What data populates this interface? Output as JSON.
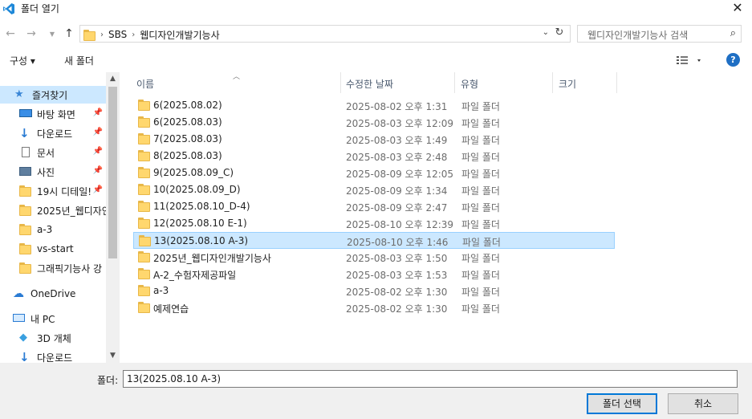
{
  "window": {
    "title": "폴더 열기",
    "close_icon": "close-icon"
  },
  "address": {
    "crumbs": [
      "SBS",
      "웹디자인개발기능사"
    ],
    "search_placeholder": "웹디자인개발기능사 검색"
  },
  "toolbar": {
    "organize_label": "구성 ▾",
    "new_folder_label": "새 폴더"
  },
  "nav": {
    "items": [
      {
        "label": "즐겨찾기",
        "icon": "star-icon",
        "pinned": false
      },
      {
        "label": "바탕 화면",
        "icon": "desktop-icon",
        "pinned": true
      },
      {
        "label": "다운로드",
        "icon": "download-icon",
        "pinned": true
      },
      {
        "label": "문서",
        "icon": "document-icon",
        "pinned": true
      },
      {
        "label": "사진",
        "icon": "picture-icon",
        "pinned": true
      },
      {
        "label": "19시 디테일!",
        "icon": "folder-icon",
        "pinned": true
      },
      {
        "label": "2025년_웹디자인",
        "icon": "folder-icon",
        "pinned": false
      },
      {
        "label": "a-3",
        "icon": "folder-icon",
        "pinned": false
      },
      {
        "label": "vs-start",
        "icon": "folder-icon",
        "pinned": false
      },
      {
        "label": "그래픽기능사 강",
        "icon": "folder-icon",
        "pinned": false
      },
      {
        "label": "OneDrive",
        "icon": "cloud-icon",
        "pinned": false
      },
      {
        "label": "내 PC",
        "icon": "pc-icon",
        "pinned": false
      },
      {
        "label": "3D 개체",
        "icon": "cube-icon",
        "pinned": false
      },
      {
        "label": "다운로드",
        "icon": "download-icon",
        "pinned": false
      }
    ]
  },
  "columns": {
    "name": "이름",
    "modified": "수정한 날짜",
    "type": "유형",
    "size": "크기"
  },
  "files": [
    {
      "name": "6(2025.08.02)",
      "modified": "2025-08-02 오후 1:31",
      "type": "파일 폴더",
      "selected": false
    },
    {
      "name": "6(2025.08.03)",
      "modified": "2025-08-03 오후 12:09",
      "type": "파일 폴더",
      "selected": false
    },
    {
      "name": "7(2025.08.03)",
      "modified": "2025-08-03 오후 1:49",
      "type": "파일 폴더",
      "selected": false
    },
    {
      "name": "8(2025.08.03)",
      "modified": "2025-08-03 오후 2:48",
      "type": "파일 폴더",
      "selected": false
    },
    {
      "name": "9(2025.08.09_C)",
      "modified": "2025-08-09 오후 12:05",
      "type": "파일 폴더",
      "selected": false
    },
    {
      "name": "10(2025.08.09_D)",
      "modified": "2025-08-09 오후 1:34",
      "type": "파일 폴더",
      "selected": false
    },
    {
      "name": "11(2025.08.10_D-4)",
      "modified": "2025-08-09 오후 2:47",
      "type": "파일 폴더",
      "selected": false
    },
    {
      "name": "12(2025.08.10 E-1)",
      "modified": "2025-08-10 오후 12:39",
      "type": "파일 폴더",
      "selected": false
    },
    {
      "name": "13(2025.08.10 A-3)",
      "modified": "2025-08-10 오후 1:46",
      "type": "파일 폴더",
      "selected": true
    },
    {
      "name": "2025년_웹디자인개발기능사",
      "modified": "2025-08-03 오후 1:50",
      "type": "파일 폴더",
      "selected": false
    },
    {
      "name": "A-2_수험자제공파일",
      "modified": "2025-08-03 오후 1:53",
      "type": "파일 폴더",
      "selected": false
    },
    {
      "name": "a-3",
      "modified": "2025-08-02 오후 1:30",
      "type": "파일 폴더",
      "selected": false
    },
    {
      "name": "예제연습",
      "modified": "2025-08-02 오후 1:30",
      "type": "파일 폴더",
      "selected": false
    }
  ],
  "footer": {
    "folder_label": "폴더:",
    "folder_value": "13(2025.08.10 A-3)",
    "select_label": "폴더 선택",
    "cancel_label": "취소"
  },
  "colors": {
    "accent": "#0078d7",
    "selection_bg": "#cce8ff",
    "selection_border": "#99d1ff",
    "help": "#1f6fc4"
  }
}
